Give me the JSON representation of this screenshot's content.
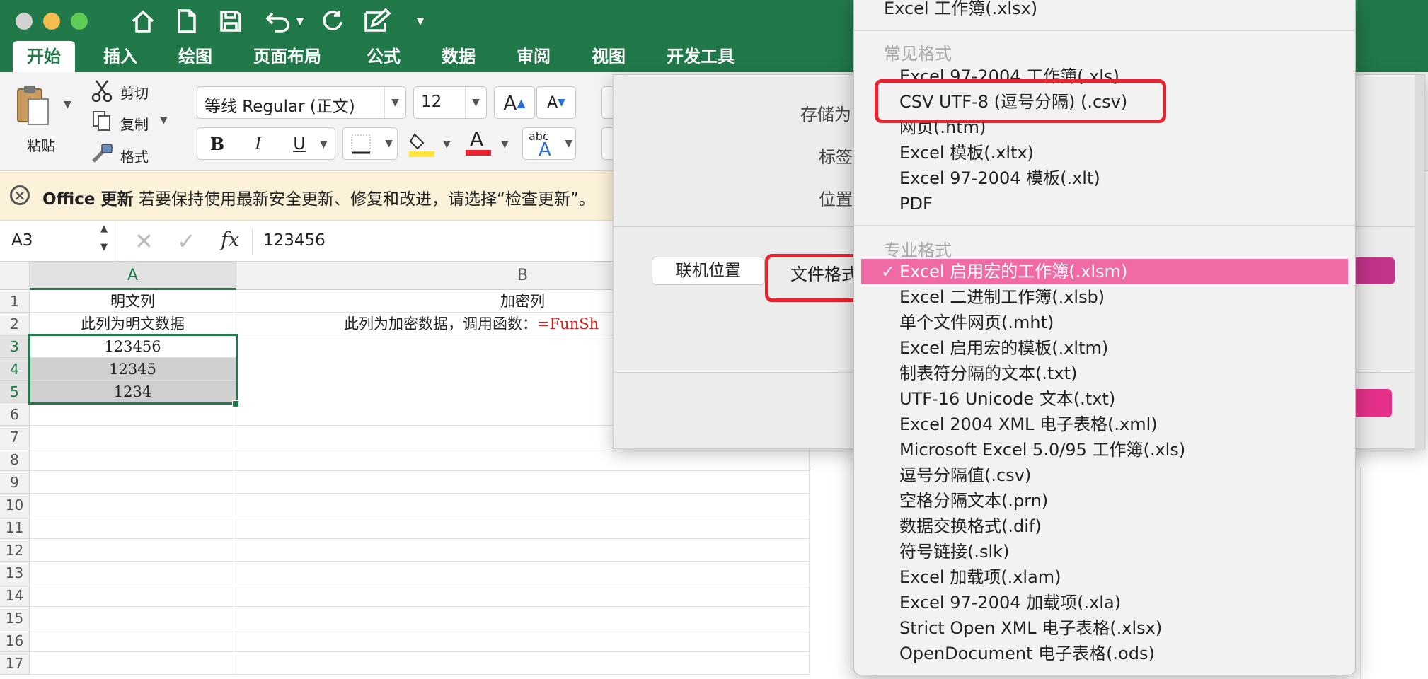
{
  "app": {
    "tabs": [
      "开始",
      "插入",
      "绘图",
      "页面布局",
      "公式",
      "数据",
      "审阅",
      "视图",
      "开发工具"
    ],
    "active_tab": "开始"
  },
  "ribbon": {
    "paste_label": "粘贴",
    "cut_label": "剪切",
    "copy_label": "复制",
    "format_label": "格式",
    "font_name": "等线 Regular (正文)",
    "font_size": "12",
    "bold": "B",
    "italic": "I",
    "underline": "U",
    "font_color_glyph": "A",
    "abc_label": "abc",
    "grow_font": "A",
    "shrink_font": "A"
  },
  "notification": {
    "title": "Office 更新",
    "message": "若要保持使用最新安全更新、修复和改进，请选择“检查更新”。"
  },
  "formula_bar": {
    "name_box": "A3",
    "fx": "fx",
    "value": "123456"
  },
  "sheet": {
    "columns": [
      "A",
      "B"
    ],
    "rows": [
      "1",
      "2",
      "3",
      "4",
      "5",
      "6",
      "7",
      "8",
      "9",
      "10",
      "11",
      "12",
      "13",
      "14",
      "15",
      "16",
      "17"
    ],
    "A1": "明文列",
    "A2": "此列为明文数据",
    "A3": "123456",
    "A4": "12345",
    "A5": "1234",
    "B1": "加密列",
    "B2_prefix": "此列为加密数据，调用函数：",
    "B2_formula": "=FunSh"
  },
  "dialog": {
    "save_as_label": "存储为",
    "tags_label": "标签",
    "location_label": "位置",
    "online_button": "联机位置",
    "file_format_label": "文件格式"
  },
  "menu": {
    "top_item": "Excel 工作簿(.xlsx)",
    "common_header": "常见格式",
    "common_items": [
      "Excel 97-2004 工作簿(.xls)",
      "CSV UTF-8 (逗号分隔) (.csv)",
      "网页(.htm)",
      "Excel 模板(.xltx)",
      "Excel 97-2004 模板(.xlt)",
      "PDF"
    ],
    "pro_header": "专业格式",
    "pro_items": [
      "Excel 启用宏的工作簿(.xlsm)",
      "Excel 二进制工作簿(.xlsb)",
      "单个文件网页(.mht)",
      "Excel 启用宏的模板(.xltm)",
      "制表符分隔的文本(.txt)",
      "UTF-16 Unicode 文本(.txt)",
      "Excel 2004 XML 电子表格(.xml)",
      "Microsoft Excel 5.0/95 工作簿(.xls)",
      "逗号分隔值(.csv)",
      "空格分隔文本(.prn)",
      "数据交换格式(.dif)",
      "符号链接(.slk)",
      "Excel 加载项(.xlam)",
      "Excel 97-2004 加载项(.xla)",
      "Strict Open XML 电子表格(.xlsx)",
      "OpenDocument 电子表格(.ods)"
    ],
    "selected_item": "Excel 启用宏的工作簿(.xlsm)",
    "check": "✓"
  },
  "colors": {
    "excel_green": "#21794a",
    "selection_pink": "#f06aa5",
    "highlight_red": "#e8222f",
    "formula_red": "#d61f1f"
  }
}
